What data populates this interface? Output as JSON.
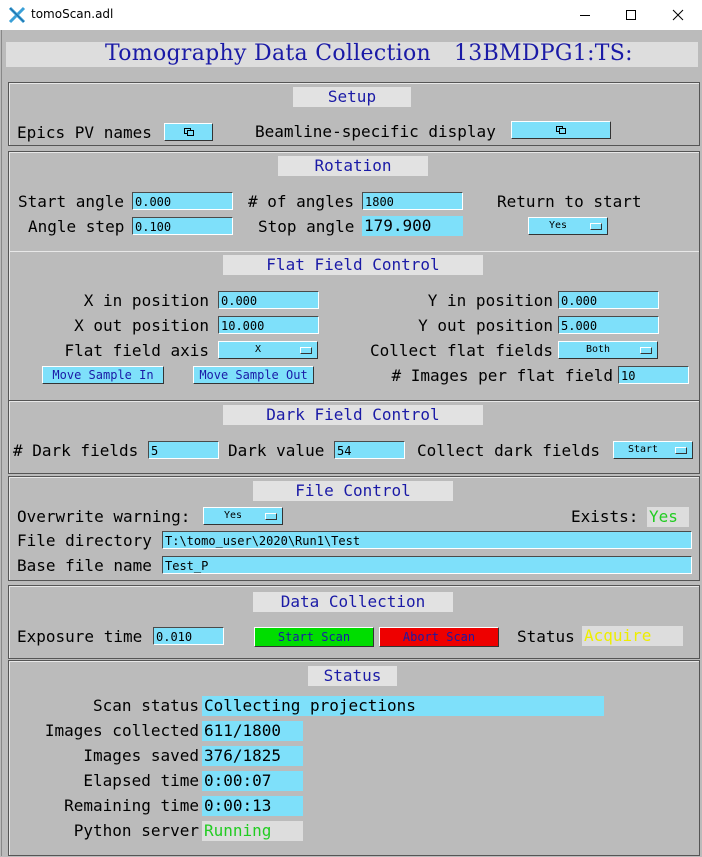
{
  "window": {
    "title": "tomoScan.adl"
  },
  "header": {
    "title": "Tomography Data Collection",
    "prefix": "13BMDPG1:TS:"
  },
  "setup": {
    "title": "Setup",
    "epics_pv_names_label": "Epics PV names",
    "beamline_display_label": "Beamline-specific display"
  },
  "rotation": {
    "title": "Rotation",
    "start_angle_label": "Start angle",
    "start_angle": "0.000",
    "num_angles_label": "# of angles",
    "num_angles": "1800",
    "return_label": "Return to start",
    "return_value": "Yes",
    "angle_step_label": "Angle step",
    "angle_step": "0.100",
    "stop_angle_label": "Stop angle",
    "stop_angle": "179.900"
  },
  "flat": {
    "title": "Flat Field Control",
    "x_in_label": "X in position",
    "x_in": "0.000",
    "y_in_label": "Y in position",
    "y_in": "0.000",
    "x_out_label": "X out position",
    "x_out": "10.000",
    "y_out_label": "Y out position",
    "y_out": "5.000",
    "axis_label": "Flat field axis",
    "axis_value": "X",
    "collect_label": "Collect flat fields",
    "collect_value": "Both",
    "move_in": "Move Sample In",
    "move_out": "Move Sample Out",
    "per_flat_label": "# Images per flat field",
    "per_flat": "10"
  },
  "dark": {
    "title": "Dark Field Control",
    "num_label": "# Dark fields",
    "num": "5",
    "value_label": "Dark value",
    "value": "54",
    "collect_label": "Collect dark fields",
    "collect_value": "Start"
  },
  "file": {
    "title": "File Control",
    "overwrite_label": "Overwrite warning:",
    "overwrite_value": "Yes",
    "exists_label": "Exists:",
    "exists_value": "Yes",
    "dir_label": "File directory",
    "dir": "T:\\tomo_user\\2020\\Run1\\Test",
    "base_label": "Base file name",
    "base": "Test_P"
  },
  "data": {
    "title": "Data Collection",
    "exposure_label": "Exposure time",
    "exposure": "0.010",
    "start_scan": "Start Scan",
    "abort_scan": "Abort Scan",
    "status_label": "Status",
    "status_value": "Acquire"
  },
  "status": {
    "title": "Status",
    "scan_status_label": "Scan status",
    "scan_status": "Collecting projections",
    "collected_label": "Images collected",
    "collected": "611/1800",
    "saved_label": "Images saved",
    "saved": "376/1825",
    "elapsed_label": "Elapsed time",
    "elapsed": "0:00:07",
    "remaining_label": "Remaining time",
    "remaining": "0:00:13",
    "python_label": "Python server",
    "python": "Running"
  },
  "colors": {
    "accent": "#1a1aa6",
    "field": "#7ee0fa",
    "ok": "#22cc22",
    "start": "#00dd00",
    "abort": "#ee0000",
    "warn": "#eeee00"
  }
}
